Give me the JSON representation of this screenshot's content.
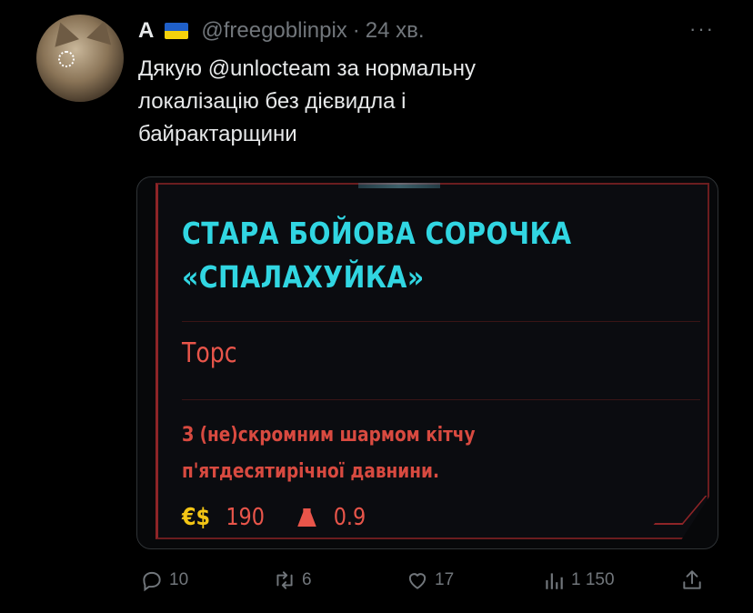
{
  "author": {
    "display_name": "A",
    "handle": "@freegoblinpix",
    "separator": "·",
    "time": "24 хв.",
    "flag_icon": "ukraine-flag-icon"
  },
  "menu": {
    "more_label": "···"
  },
  "tweet": {
    "lines": [
      "Дякую @unlocteam за нормальну",
      "локалізацію без дієвидла і",
      "байрактарщини"
    ]
  },
  "media": {
    "item_title_line1": "СТАРА БОЙОВА СОРОЧКА",
    "item_title_line2": "«СПАЛАХУЙКА»",
    "slot": "Торс",
    "description_line1": "З (не)скромним шармом кітчу",
    "description_line2": "п'ятдесятирічної давнини.",
    "currency_symbol": "€$",
    "price": "190",
    "weight": "0.9",
    "colors": {
      "title": "#31d6e2",
      "accent_red": "#e8554a",
      "currency": "#f3c515"
    }
  },
  "actions": {
    "replies": "10",
    "retweets": "6",
    "likes": "17",
    "views": "1 150"
  }
}
